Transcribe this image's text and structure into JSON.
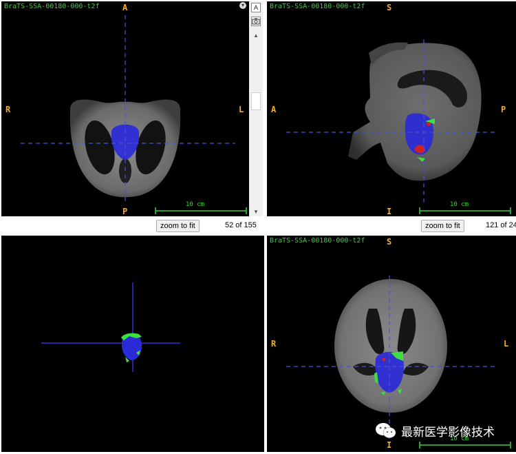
{
  "colors": {
    "background": "#000000",
    "crosshair": "#4a52d8",
    "label_green": "#3ad13a",
    "orientation_orange": "#f2b030",
    "tumor_blue": "#2a2ad8",
    "tumor_green": "#3ee03e",
    "tumor_red": "#d02020"
  },
  "panes": {
    "axial": {
      "volume_label": "BraTS-SSA-00180-000-t2f",
      "orient_top": "A",
      "orient_bottom": "P",
      "orient_left": "R",
      "orient_right": "L",
      "scale_label": "10 cm",
      "zoom_label": "zoom to fit",
      "slice_counter": "52 of 155"
    },
    "sagittal": {
      "volume_label": "BraTS-SSA-00180-000-t2f",
      "orient_top": "S",
      "orient_bottom": "I",
      "orient_left": "A",
      "orient_right": "P",
      "scale_label": "10 cm",
      "zoom_label": "zoom to fit",
      "slice_counter": "121 of 24"
    },
    "render3d": {},
    "coronal": {
      "volume_label": "BraTS-SSA-00180-000-t2f",
      "orient_top": "S",
      "orient_bottom": "I",
      "orient_left": "R",
      "orient_right": "L",
      "scale_label": "10 cm"
    }
  },
  "toolbar": {
    "text_tool": "A",
    "camera_icon": "camera-icon"
  },
  "watermark": {
    "text": "最新医学影像技术",
    "icon": "wechat-icon"
  }
}
